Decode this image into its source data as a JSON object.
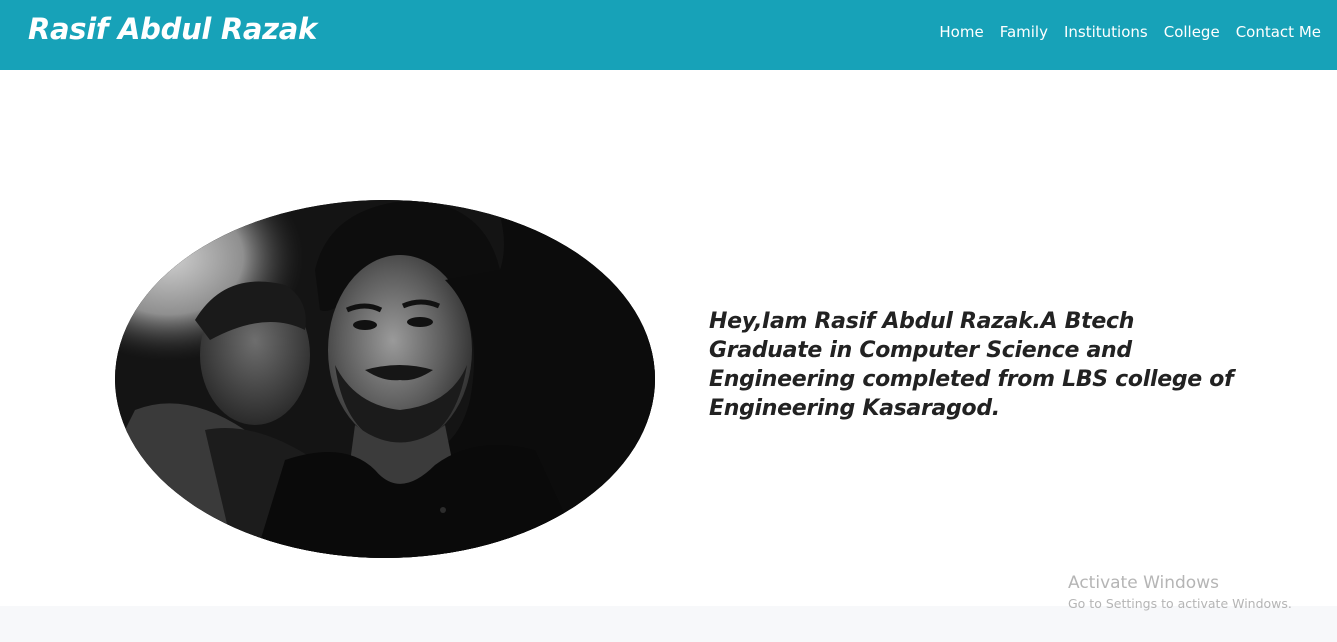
{
  "navbar": {
    "brand": "Rasif Abdul Razak",
    "links": [
      "Home",
      "Family",
      "Institutions",
      "College",
      "Contact Me"
    ],
    "background_color": "#17a2b8"
  },
  "hero": {
    "intro": "Hey,Iam Rasif Abdul Razak.A Btech Graduate in Computer Science and Engineering completed from LBS college of Engineering Kasaragod."
  },
  "watermark": {
    "title": "Activate Windows",
    "subtitle": "Go to Settings to activate Windows."
  }
}
